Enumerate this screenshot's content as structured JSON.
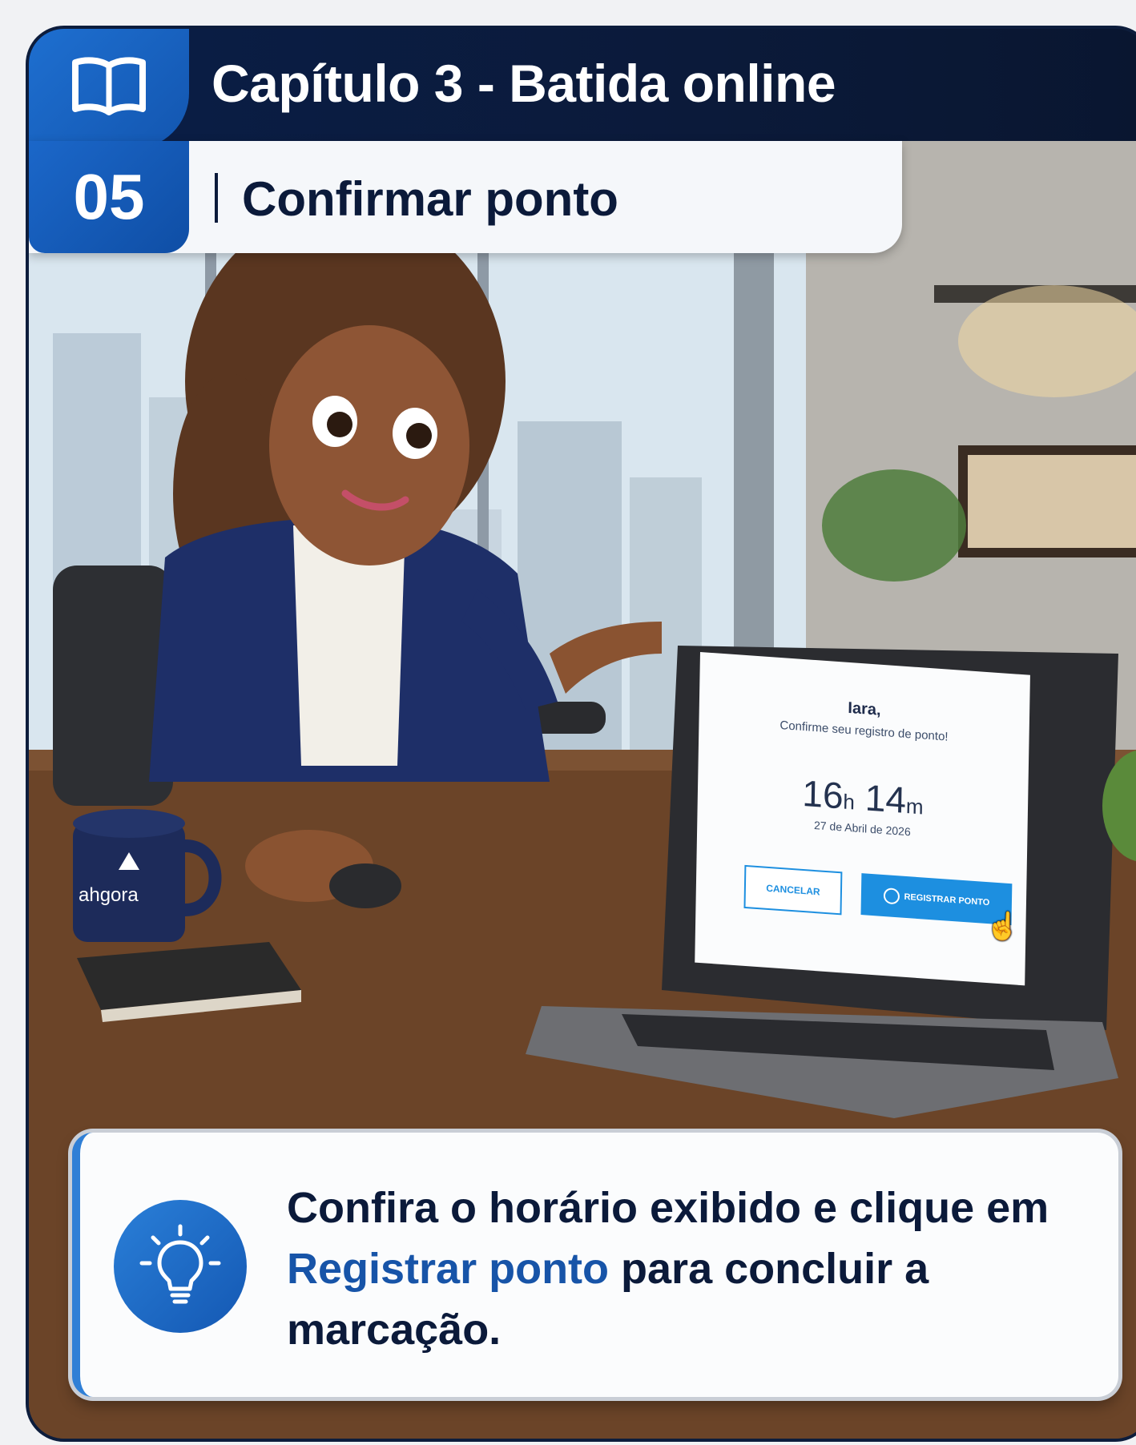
{
  "header": {
    "chapter_title": "Capítulo 3 - Batida online",
    "step_number": "05",
    "step_title": "Confirmar ponto"
  },
  "laptop_screen": {
    "name": "Iara,",
    "message": "Confirme seu registro de ponto!",
    "hours": "16",
    "hours_unit": "h",
    "minutes": "14",
    "minutes_unit": "m",
    "date": "27 de Abril de 2026",
    "cancel_label": "CANCELAR",
    "register_label": "REGISTRAR PONTO"
  },
  "mug": {
    "brand": "ahgora"
  },
  "tip": {
    "text_before": "Confira o horário exibido e clique em ",
    "highlight": "Registrar ponto",
    "text_after": " para concluir a marcação."
  },
  "icons": [
    "book-icon",
    "lightbulb-icon",
    "check-circle-icon",
    "hand-cursor-icon"
  ],
  "colors": {
    "brand_blue": "#1b67c9",
    "navy": "#0b1a3a",
    "button_blue": "#1d8fe0",
    "highlight_blue": "#1754a8"
  }
}
